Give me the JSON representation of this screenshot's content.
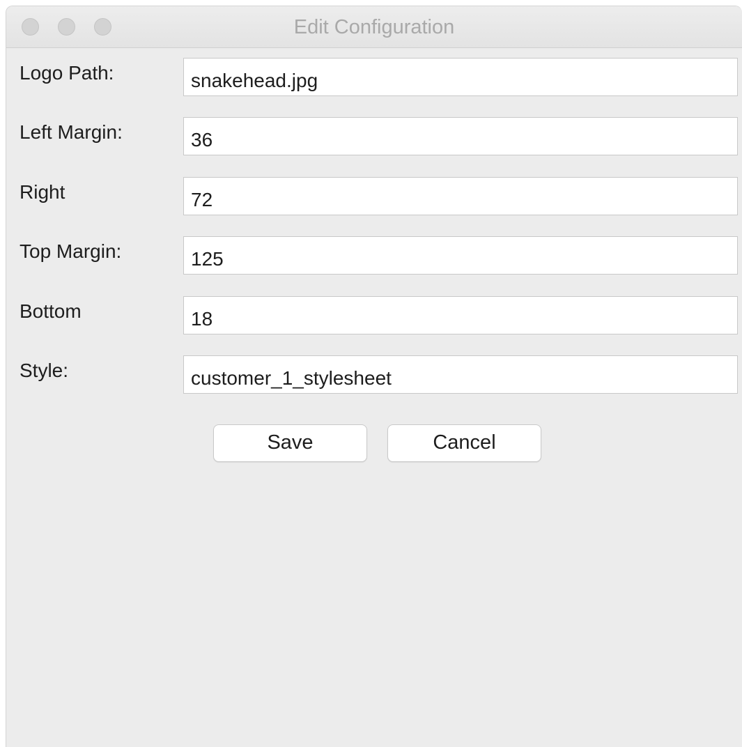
{
  "window": {
    "title": "Edit Configuration"
  },
  "form": {
    "fields": [
      {
        "label": "Logo Path:",
        "value": "snakehead.jpg"
      },
      {
        "label": "Left Margin:",
        "value": "36"
      },
      {
        "label": "Right",
        "value": "72"
      },
      {
        "label": "Top Margin:",
        "value": "125"
      },
      {
        "label": "Bottom",
        "value": "18"
      },
      {
        "label": "Style:",
        "value": "customer_1_stylesheet"
      }
    ]
  },
  "buttons": {
    "save_label": "Save",
    "cancel_label": "Cancel"
  },
  "colors": {
    "window_background": "#ececec",
    "field_background": "#ffffff",
    "title_text": "#a9a9a9"
  }
}
